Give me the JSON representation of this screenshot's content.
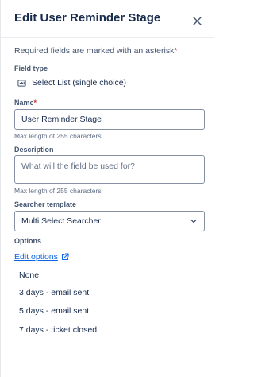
{
  "dialog": {
    "title": "Edit User Reminder Stage",
    "required_note": "Required fields are marked with an asterisk",
    "required_marker": "*"
  },
  "field_type": {
    "label": "Field type",
    "value": "Select List (single choice)",
    "icon": "select-list-icon"
  },
  "name": {
    "label": "Name",
    "required_marker": "*",
    "value": "User Reminder Stage",
    "helper": "Max length of 255 characters"
  },
  "description": {
    "label": "Description",
    "placeholder": "What will the field be used for?",
    "helper": "Max length of 255 characters"
  },
  "searcher_template": {
    "label": "Searcher template",
    "value": "Multi Select Searcher"
  },
  "options": {
    "label": "Options",
    "edit_link": "Edit options",
    "items": [
      "None",
      "3 days - email sent",
      "5 days - email sent",
      "7 days - ticket closed"
    ]
  },
  "colors": {
    "text": "#172b4d",
    "subtle": "#44546f",
    "link": "#0c66e4",
    "required": "#c9372c",
    "border": "#8590a2"
  }
}
